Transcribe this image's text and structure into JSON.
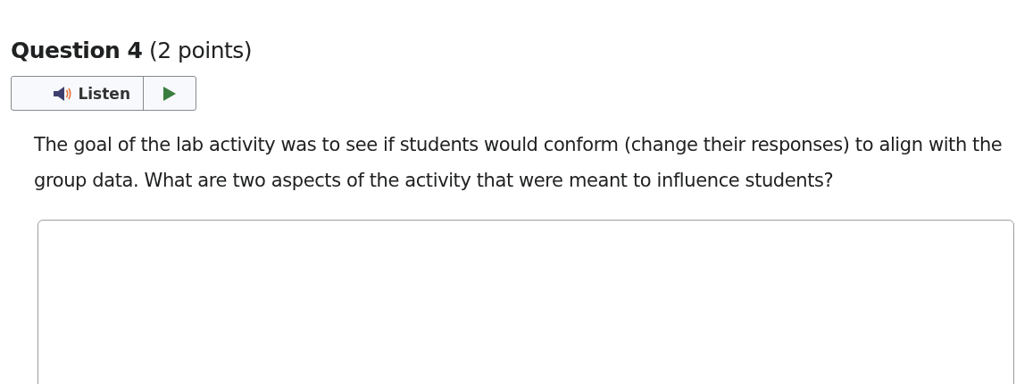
{
  "question": {
    "heading": "**Question 4** (2 points)",
    "listen_label": "Listen",
    "prompt": "The goal of the lab activity was to see if students would conform (change their responses) to align with the group data. What are two aspects of the activity that were meant to influence students?"
  },
  "answer": {
    "kind": "textarea"
  }
}
